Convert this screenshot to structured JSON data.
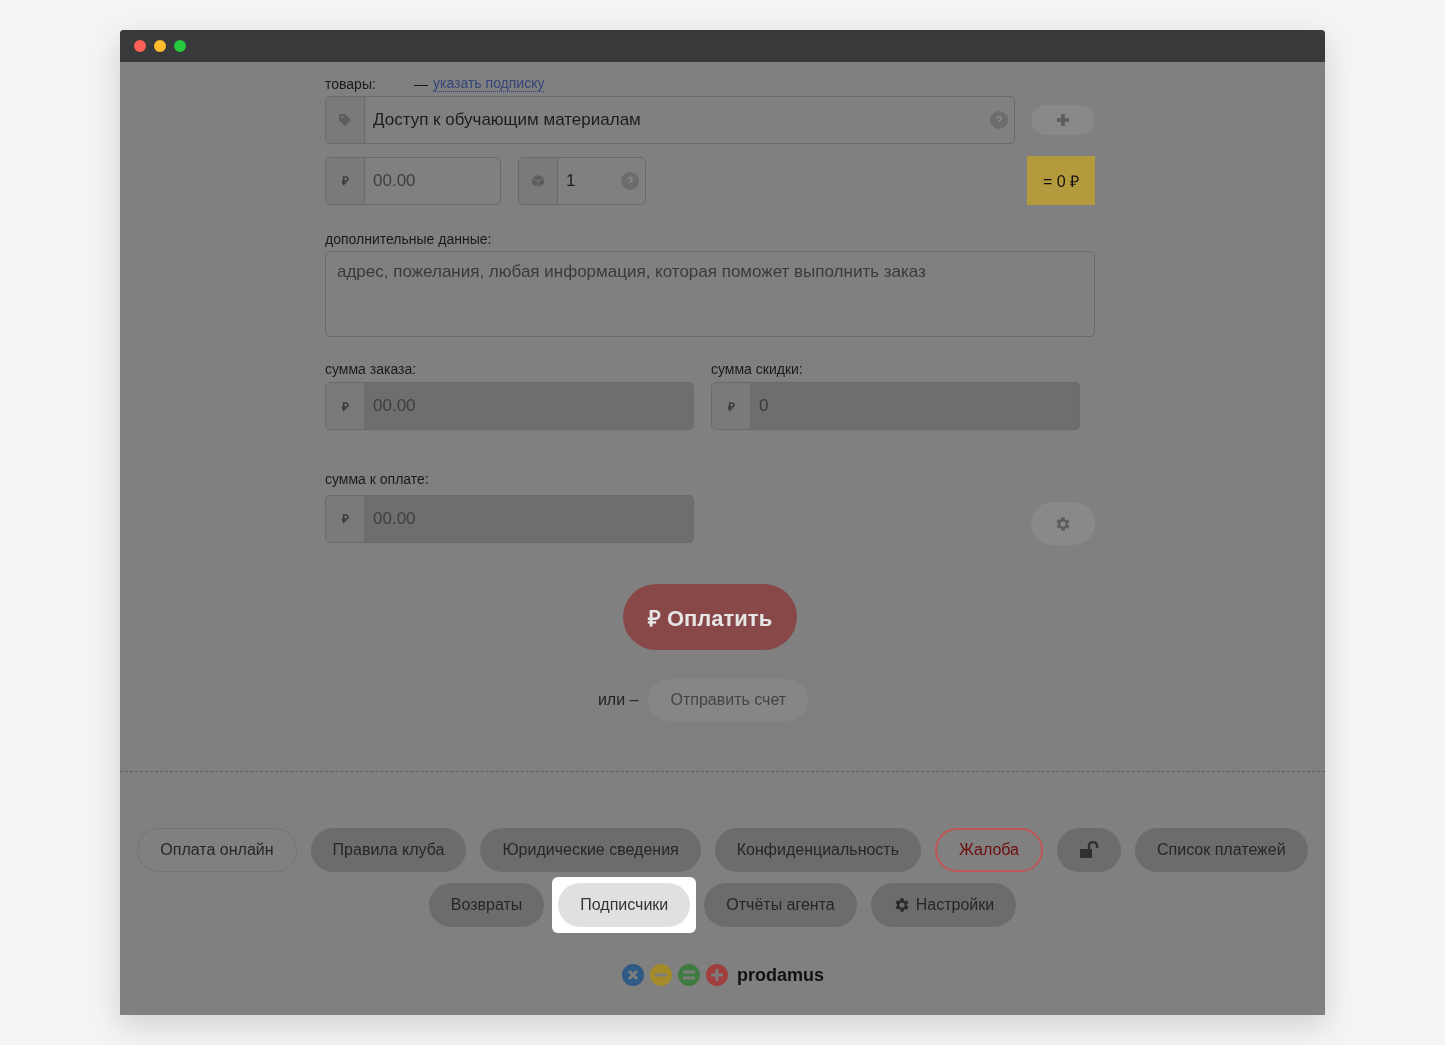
{
  "products": {
    "label": "товары:",
    "link_prefix": "—",
    "link": "указать подписку",
    "name": "Доступ к обучающим материалам",
    "price_currency": "₽",
    "price_placeholder": "00.00",
    "quantity": "1",
    "total": "= 0 ₽"
  },
  "extra": {
    "label": "дополнительные данные:",
    "placeholder": "адрес, пожелания, любая информация, которая поможет выполнить заказ"
  },
  "order_sum": {
    "label": "сумма заказа:",
    "currency": "₽",
    "placeholder": "00.00"
  },
  "discount": {
    "label": "сумма скидки:",
    "currency": "₽",
    "value": "0"
  },
  "to_pay": {
    "label": "сумма к оплате:",
    "currency": "₽",
    "placeholder": "00.00"
  },
  "pay_button": "₽ Оплатить",
  "or_label": "или –",
  "invoice_button": "Отправить счет",
  "nav_rows": [
    [
      {
        "kind": "outline",
        "label": "Оплата онлайн",
        "highlighted": false
      },
      {
        "kind": "filled",
        "label": "Правила клуба",
        "highlighted": false
      },
      {
        "kind": "filled",
        "label": "Юридические сведения",
        "highlighted": false
      },
      {
        "kind": "filled",
        "label": "Конфиденциальность",
        "highlighted": false
      },
      {
        "kind": "danger",
        "label": "Жалоба",
        "highlighted": false
      },
      {
        "kind": "lock",
        "highlighted": false
      },
      {
        "kind": "filled",
        "label": "Список платежей",
        "highlighted": false
      }
    ],
    [
      {
        "kind": "filled",
        "label": "Возвраты",
        "highlighted": false
      },
      {
        "kind": "filled",
        "label": "Подписчики",
        "highlighted": true
      },
      {
        "kind": "filled",
        "label": "Отчёты агента",
        "highlighted": false
      },
      {
        "kind": "settings",
        "label": "Настройки",
        "highlighted": false
      }
    ]
  ],
  "brand": "prodamus"
}
